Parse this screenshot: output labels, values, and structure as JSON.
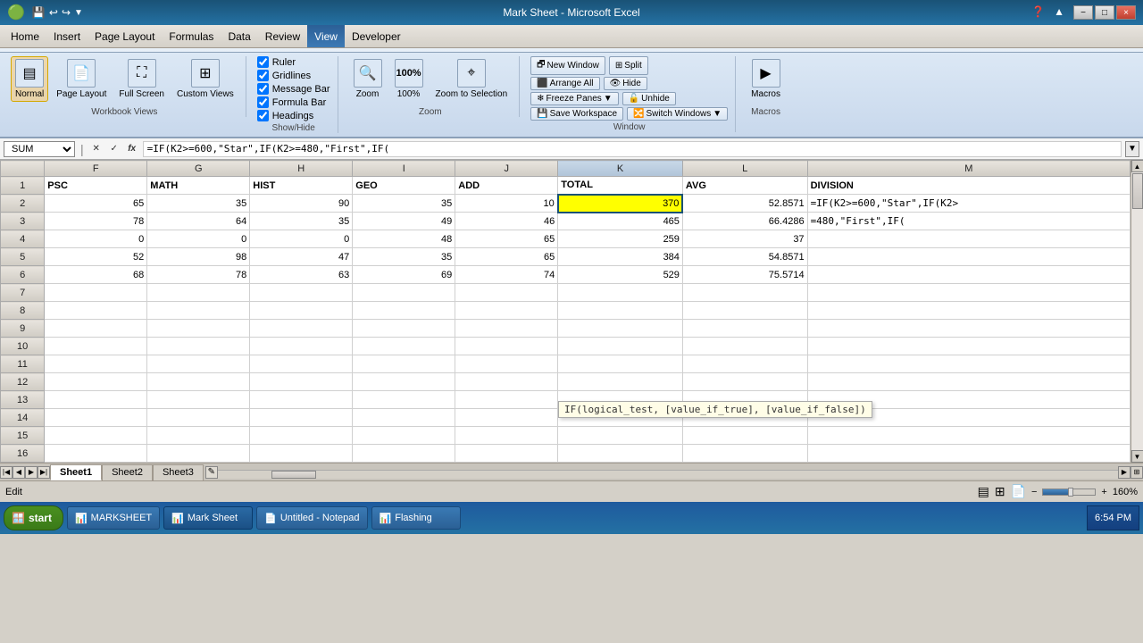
{
  "titlebar": {
    "title": "Mark Sheet - Microsoft Excel",
    "minimize": "−",
    "restore": "□",
    "close": "×",
    "app_minimize": "−",
    "app_restore": "□",
    "app_close": "×"
  },
  "menu": {
    "items": [
      "Home",
      "Insert",
      "Page Layout",
      "Formulas",
      "Data",
      "Review",
      "View",
      "Developer"
    ],
    "active": "View"
  },
  "ribbon": {
    "workbook_views": {
      "label": "Workbook Views",
      "normal": "Normal",
      "page_layout": "Page Layout",
      "full_screen": "Full Screen",
      "custom_views": "Custom Views"
    },
    "show_hide": {
      "label": "Show/Hide",
      "ruler": "Ruler",
      "gridlines": "Gridlines",
      "message_bar": "Message Bar",
      "formula_bar": "Formula Bar",
      "headings": "Headings"
    },
    "zoom": {
      "label": "Zoom",
      "zoom": "Zoom",
      "100pct": "100%",
      "zoom_to_selection": "Zoom to Selection"
    },
    "window": {
      "label": "Window",
      "new_window": "New Window",
      "arrange_all": "Arrange All",
      "freeze_panes": "Freeze Panes",
      "split": "Split",
      "hide": "Hide",
      "unhide": "Unhide",
      "save_workspace": "Save Workspace",
      "switch_windows": "Switch Windows"
    },
    "macros": {
      "label": "Macros",
      "macros": "Macros"
    }
  },
  "formula_bar": {
    "name_box": "SUM",
    "formula": "=IF(K2>=600,\"Star\",IF(K2>=480,\"First\",IF(",
    "cancel": "✕",
    "enter": "✓",
    "fx": "fx"
  },
  "columns": {
    "corner": "",
    "headers": [
      "F",
      "G",
      "H",
      "I",
      "J",
      "K",
      "L",
      "M"
    ],
    "widths": [
      70,
      70,
      70,
      70,
      70,
      85,
      85,
      220
    ]
  },
  "rows": [
    {
      "row": "1",
      "cells": [
        "PSC",
        "MATH",
        "HIST",
        "GEO",
        "ADD",
        "TOTAL",
        "AVG",
        "DIVISION"
      ],
      "types": [
        "header-cell",
        "header-cell",
        "header-cell",
        "header-cell",
        "header-cell",
        "header-cell",
        "header-cell",
        "header-cell"
      ]
    },
    {
      "row": "2",
      "cells": [
        "65",
        "35",
        "90",
        "35",
        "10",
        "370",
        "52.8571",
        "=IF(K2>=600,\"Star\",IF(K2>"
      ],
      "types": [
        "num",
        "num",
        "num",
        "num",
        "num",
        "num selected",
        "num",
        "formula-col"
      ],
      "selected_col": 5
    },
    {
      "row": "3",
      "cells": [
        "78",
        "64",
        "35",
        "49",
        "46",
        "465",
        "66.4286",
        "=480,\"First\",IF("
      ],
      "types": [
        "num",
        "num",
        "num",
        "num",
        "num",
        "num",
        "num",
        "formula-col"
      ]
    },
    {
      "row": "4",
      "cells": [
        "0",
        "0",
        "0",
        "48",
        "65",
        "259",
        "37",
        ""
      ],
      "types": [
        "num",
        "num",
        "num",
        "num",
        "num",
        "num",
        "num",
        ""
      ]
    },
    {
      "row": "5",
      "cells": [
        "52",
        "98",
        "47",
        "35",
        "65",
        "384",
        "54.8571",
        ""
      ],
      "types": [
        "num",
        "num",
        "num",
        "num",
        "num",
        "num",
        "num",
        ""
      ]
    },
    {
      "row": "6",
      "cells": [
        "68",
        "78",
        "63",
        "69",
        "74",
        "529",
        "75.5714",
        ""
      ],
      "types": [
        "num",
        "num",
        "num",
        "num",
        "num",
        "num",
        "num",
        ""
      ]
    },
    {
      "row": "7",
      "cells": [
        "",
        "",
        "",
        "",
        "",
        "",
        "",
        ""
      ],
      "types": [
        "",
        "",
        "",
        "",
        "",
        "",
        "",
        ""
      ]
    },
    {
      "row": "8",
      "cells": [
        "",
        "",
        "",
        "",
        "",
        "",
        "",
        ""
      ],
      "types": [
        "",
        "",
        "",
        "",
        "",
        "",
        "",
        ""
      ]
    },
    {
      "row": "9",
      "cells": [
        "",
        "",
        "",
        "",
        "",
        "",
        "",
        ""
      ],
      "types": [
        "",
        "",
        "",
        "",
        "",
        "",
        "",
        ""
      ]
    },
    {
      "row": "10",
      "cells": [
        "",
        "",
        "",
        "",
        "",
        "",
        "",
        ""
      ],
      "types": [
        "",
        "",
        "",
        "",
        "",
        "",
        "",
        ""
      ]
    },
    {
      "row": "11",
      "cells": [
        "",
        "",
        "",
        "",
        "",
        "",
        "",
        ""
      ],
      "types": [
        "",
        "",
        "",
        "",
        "",
        "",
        "",
        ""
      ]
    },
    {
      "row": "12",
      "cells": [
        "",
        "",
        "",
        "",
        "",
        "",
        "",
        ""
      ],
      "types": [
        "",
        "",
        "",
        "",
        "",
        "",
        "",
        ""
      ]
    },
    {
      "row": "13",
      "cells": [
        "",
        "",
        "",
        "",
        "",
        "",
        "",
        ""
      ],
      "types": [
        "",
        "",
        "",
        "",
        "",
        "",
        "",
        ""
      ]
    },
    {
      "row": "14",
      "cells": [
        "",
        "",
        "",
        "",
        "",
        "",
        "",
        ""
      ],
      "types": [
        "",
        "",
        "",
        "",
        "",
        "",
        "",
        ""
      ]
    },
    {
      "row": "15",
      "cells": [
        "",
        "",
        "",
        "",
        "",
        "",
        "",
        ""
      ],
      "types": [
        "",
        "",
        "",
        "",
        "",
        "",
        "",
        ""
      ]
    },
    {
      "row": "16",
      "cells": [
        "",
        "",
        "",
        "",
        "",
        "",
        "",
        ""
      ],
      "types": [
        "",
        "",
        "",
        "",
        "",
        "",
        "",
        ""
      ]
    }
  ],
  "tooltip": {
    "text": "IF(logical_test, [value_if_true], [value_if_false])"
  },
  "sheet_tabs": [
    "Sheet1",
    "Sheet2",
    "Sheet3"
  ],
  "active_tab": "Sheet1",
  "status_bar": {
    "left": "Edit",
    "zoom_level": "160%",
    "zoom_minus": "−",
    "zoom_plus": "+"
  },
  "taskbar": {
    "start": "start",
    "items": [
      "MARKSHEET",
      "Mark Sheet",
      "Untitled - Notepad",
      "Flashing"
    ],
    "icons": [
      "🪟",
      "📊",
      "📄",
      "📊"
    ],
    "time": "6:54 PM"
  }
}
